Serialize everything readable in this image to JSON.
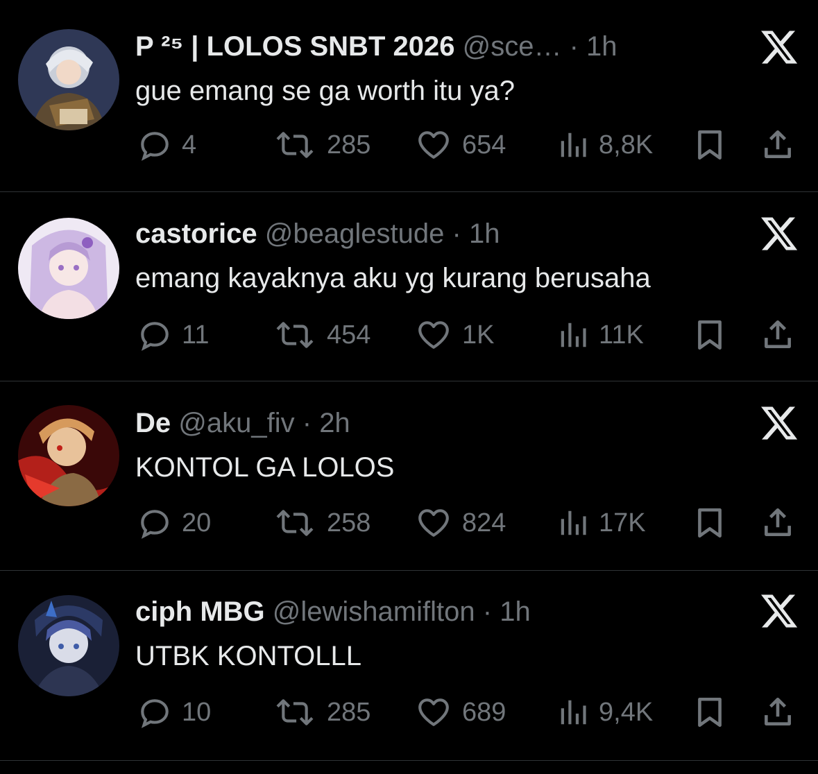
{
  "tweets": [
    {
      "name": "P ²⁵ | LOLOS SNBT 2026",
      "handle": "@sce…",
      "sep": "·",
      "time": "1h",
      "text": "gue emang se ga worth itu ya?",
      "replies": "4",
      "retweets": "285",
      "likes": "654",
      "views": "8,8K",
      "avatar_colors": [
        "#3a4668",
        "#c9ced8",
        "#8a6a3c"
      ]
    },
    {
      "name": "castorice",
      "handle": "@beaglestude",
      "sep": "·",
      "time": "1h",
      "text": "emang kayaknya aku yg kurang berusaha",
      "replies": "11",
      "retweets": "454",
      "likes": "1K",
      "views": "11K",
      "avatar_colors": [
        "#ece6f2",
        "#b79bd4",
        "#f3dfe4"
      ]
    },
    {
      "name": "De",
      "handle": "@aku_fiv",
      "sep": "·",
      "time": "2h",
      "text": "KONTOL GA LOLOS",
      "replies": "20",
      "retweets": "258",
      "likes": "824",
      "views": "17K",
      "avatar_colors": [
        "#4a0c0c",
        "#d1281e",
        "#e0a574"
      ]
    },
    {
      "name": "ciph MBG",
      "handle": "@lewishamiflton",
      "sep": "·",
      "time": "1h",
      "text": "UTBK KONTOLLL",
      "replies": "10",
      "retweets": "285",
      "likes": "689",
      "views": "9,4K",
      "avatar_colors": [
        "#1c2338",
        "#3f5ca8",
        "#8e9cc4"
      ]
    }
  ],
  "icons": {
    "reply": "reply-icon",
    "retweet": "retweet-icon",
    "like": "heart-icon",
    "views": "views-icon",
    "bookmark": "bookmark-icon",
    "share": "share-icon",
    "x_logo": "x-logo-icon"
  },
  "theme": {
    "background": "#000000",
    "text": "#e7e9ea",
    "muted": "#71767b",
    "divider": "#2f3336"
  }
}
